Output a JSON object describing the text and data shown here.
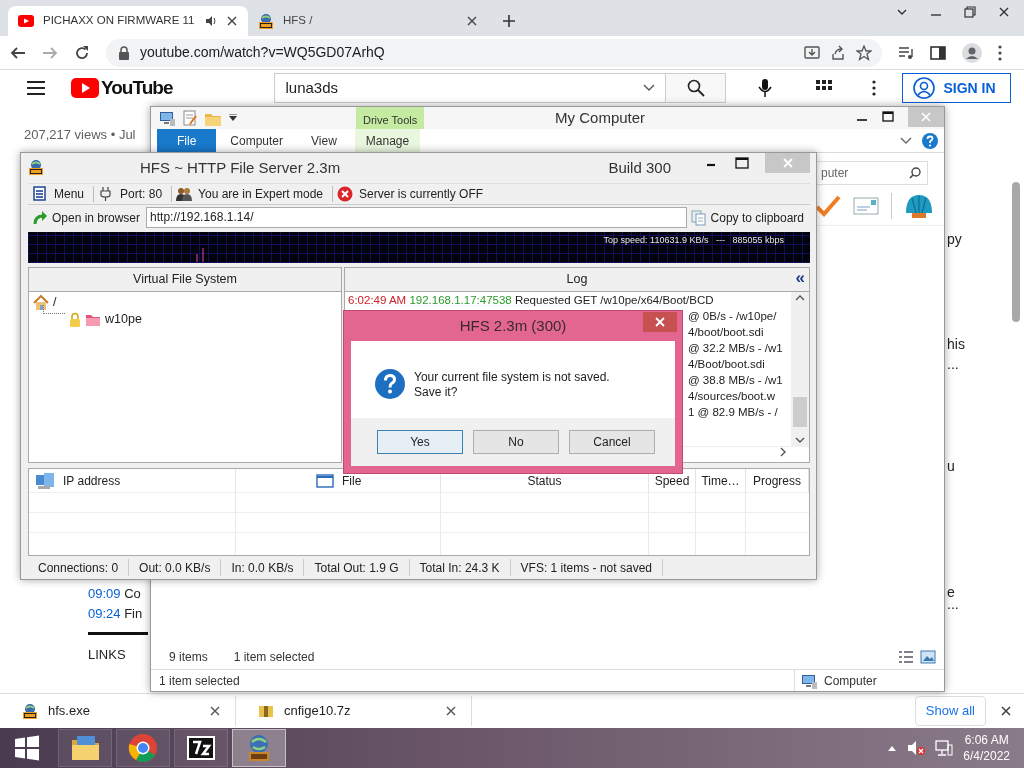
{
  "browser": {
    "tabs": [
      {
        "title": "PICHAXX ON FIRMWARE 11",
        "selected": true,
        "kind": "video",
        "audio": true
      },
      {
        "title": "HFS /",
        "selected": false,
        "kind": "hfs",
        "audio": false
      }
    ],
    "url": "youtube.com/watch?v=WQ5GD07ArhQ"
  },
  "page": {
    "logo": "YouTube",
    "search": "luna3ds",
    "sign_in": "SIGN IN",
    "views": "207,217 views • Jul",
    "chapters": [
      {
        "time": "09:09",
        "title": "Co"
      },
      {
        "time": "09:24",
        "title": "Fin"
      }
    ],
    "links_heading": "LINKS",
    "side_fragments": [
      "py",
      "his",
      "...",
      "u",
      "e",
      "..."
    ]
  },
  "downloads": {
    "items": [
      {
        "name": "hfs.exe",
        "kind": "hfs"
      },
      {
        "name": "cnfige10.7z",
        "kind": "archive"
      }
    ],
    "show_all": "Show all"
  },
  "explorer": {
    "title": "My Computer",
    "context_group": "Drive Tools",
    "ribbon_tabs": [
      {
        "label": "File",
        "kind": "file"
      },
      {
        "label": "Computer",
        "kind": "tab"
      },
      {
        "label": "View",
        "kind": "tab"
      },
      {
        "label": "Manage",
        "kind": "context"
      }
    ],
    "search": "puter",
    "item_count": "9 items",
    "selection": "1 item selected",
    "status": "1 item selected",
    "location": "Computer"
  },
  "hfs": {
    "title": "HFS ~ HTTP File Server 2.3m",
    "build": "Build 300",
    "toolbar": [
      {
        "kind": "menu",
        "label": "Menu"
      },
      {
        "kind": "port",
        "label": "Port: 80"
      },
      {
        "kind": "expert",
        "label": "You are in Expert mode"
      },
      {
        "kind": "server",
        "label": "Server is currently OFF"
      }
    ],
    "open_browser": "Open in browser",
    "url": "http://192.168.1.14/",
    "copy": "Copy to clipboard",
    "graph_label": "Top speed: 110631.9 KB/s   ---   885055 kbps",
    "vfs_heading": "Virtual File System",
    "tree": [
      {
        "label": "/",
        "kind": "root",
        "children": [
          {
            "label": "w10pe",
            "kind": "folder",
            "locked": true
          }
        ]
      }
    ],
    "log_heading": "Log",
    "log_toggle": "«",
    "log": [
      {
        "time": "6:02:49 AM",
        "address": "192.168.1.17:47538",
        "text": "Requested GET /w10pe/x64/Boot/BCD"
      },
      {
        "text": "@ 0B/s - /w10pe/"
      },
      {
        "text": "4/boot/boot.sdi"
      },
      {
        "text": "@ 32.2 MB/s - /w1"
      },
      {
        "text": "4/Boot/boot.sdi"
      },
      {
        "text": "@ 38.8 MB/s - /w1"
      },
      {
        "text": "4/sources/boot.w"
      },
      {
        "text": "1 @ 82.9 MB/s - /"
      }
    ],
    "columns": [
      {
        "label": "IP address",
        "kind": "ip"
      },
      {
        "label": "File",
        "kind": "file"
      },
      {
        "label": "Status",
        "kind": "plain"
      },
      {
        "label": "Speed",
        "kind": "plain"
      },
      {
        "label": "Time…",
        "kind": "plain"
      },
      {
        "label": "Progress",
        "kind": "plain"
      }
    ],
    "status": [
      "Connections: 0",
      "Out: 0.0 KB/s",
      "In: 0.0 KB/s",
      "Total Out: 1.9 G",
      "Total In: 24.3 K",
      "VFS: 1 items - not saved"
    ]
  },
  "dialog": {
    "title": "HFS 2.3m (300)",
    "message": "Your current file system is not saved.\nSave it?",
    "buttons": [
      {
        "label": "Yes",
        "focused": true
      },
      {
        "label": "No",
        "focused": false
      },
      {
        "label": "Cancel",
        "focused": false
      }
    ]
  },
  "taskbar": {
    "apps": [
      {
        "kind": "explorer",
        "selected": false
      },
      {
        "kind": "chrome",
        "selected": false
      },
      {
        "kind": "archiver",
        "selected": false
      },
      {
        "kind": "hfs",
        "selected": true
      }
    ],
    "time": "6:06 AM",
    "date": "6/4/2022"
  }
}
